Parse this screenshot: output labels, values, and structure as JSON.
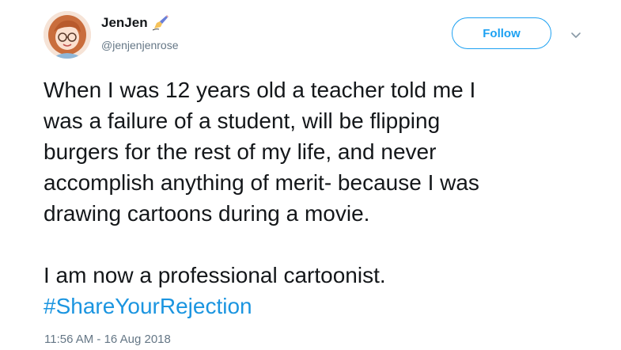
{
  "user": {
    "display_name": "JenJen",
    "handle": "@jenjenjenrose",
    "name_emoji": "writing-hand-icon"
  },
  "follow_button": {
    "label": "Follow"
  },
  "tweet": {
    "lines_para1": [
      "When I was 12 years old a teacher told me I",
      "was a failure of a student, will be flipping",
      "burgers for the rest of my life, and never",
      "accomplish anything of merit- because I was",
      "drawing cartoons during a movie."
    ],
    "para2": "I am now a professional cartoonist.",
    "hashtag": "#ShareYourRejection",
    "timestamp": "11:56 AM - 16 Aug 2018"
  },
  "colors": {
    "accent": "#1da1f2",
    "hashtag": "#1b95e0",
    "secondary_text": "#657786",
    "primary_text": "#14171a"
  }
}
